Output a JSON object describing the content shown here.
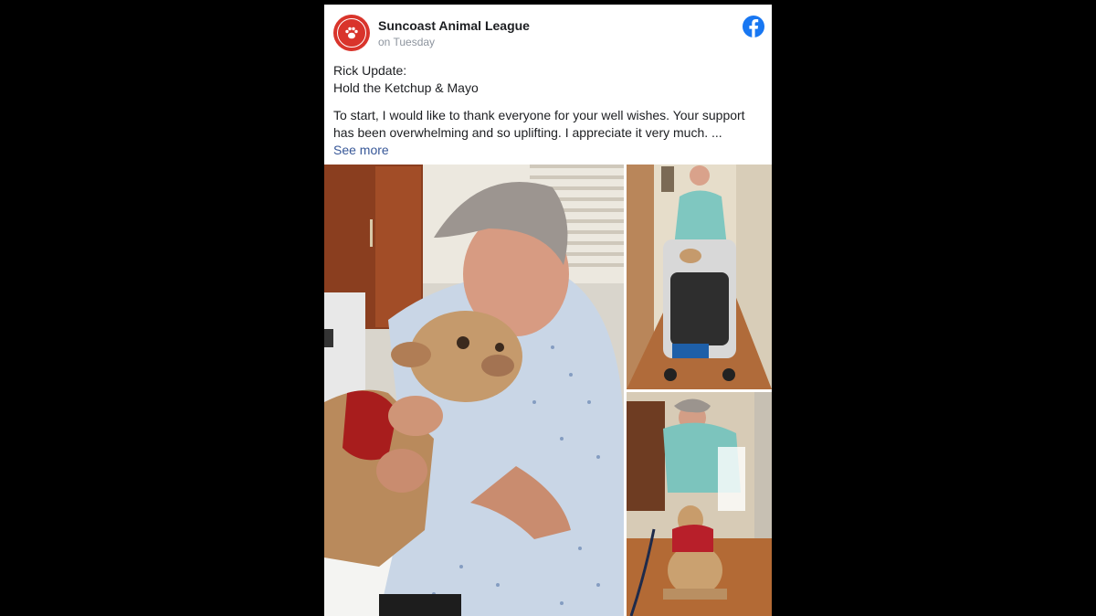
{
  "post": {
    "page_name": "Suncoast Animal League",
    "timestamp": "on Tuesday",
    "title_line1": "Rick Update:",
    "title_line2": "Hold the Ketchup & Mayo",
    "text_line1": "To start, I would like to thank everyone for your well wishes. Your support",
    "text_line2": "has been overwhelming and so uplifting. I appreciate it very much. ...",
    "see_more": "See more"
  },
  "icons": {
    "avatar": "paw-logo-icon",
    "network": "facebook-logo-icon"
  },
  "colors": {
    "background": "#000000",
    "card": "#ffffff",
    "brand_red": "#d9342b",
    "facebook_blue": "#1877f2",
    "link": "#385898",
    "meta_text": "#8d949e"
  },
  "photos": [
    {
      "name": "man-hugging-dog-photo"
    },
    {
      "name": "man-with-dog-stroller-photo"
    },
    {
      "name": "dog-greeting-man-photo"
    }
  ]
}
